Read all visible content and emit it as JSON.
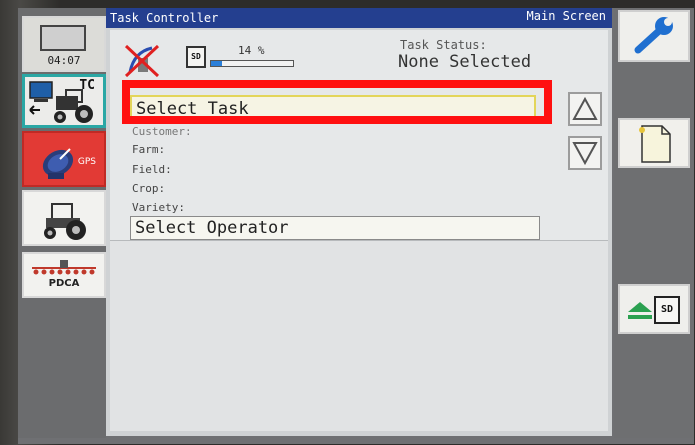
{
  "window": {
    "title": "Task Controller",
    "screen_name": "Main Screen"
  },
  "sidebar": {
    "clock": "04:07",
    "tc_label": "TC",
    "gps_label": "GPS",
    "pdca_label": "PDCA"
  },
  "status": {
    "sd_label": "SD",
    "sd_usage_text": "14 %",
    "sd_usage_fraction": 0.14,
    "task_status_label": "Task Status:",
    "task_status_value": "None Selected"
  },
  "task": {
    "select_task": "Select Task",
    "customer_label": "Customer:",
    "farm_label": "Farm:",
    "field_label": "Field:",
    "crop_label": "Crop:",
    "variety_label": "Variety:",
    "select_operator": "Select Operator"
  },
  "right_panel": {
    "sd_button_label": "SD"
  },
  "colors": {
    "titlebar": "#243f8f",
    "highlight": "#ff1010",
    "accent_teal": "#2aa7a5",
    "gps_red": "#e23a35",
    "sd_bar": "#2a7fd9"
  },
  "icons": [
    "clock-icon",
    "tractor-icon",
    "gps-satellite-icon",
    "pdca-implement-icon",
    "no-gps-icon",
    "sd-card-icon",
    "up-arrow-icon",
    "down-arrow-icon",
    "wrench-icon",
    "new-page-icon",
    "sd-eject-icon"
  ]
}
